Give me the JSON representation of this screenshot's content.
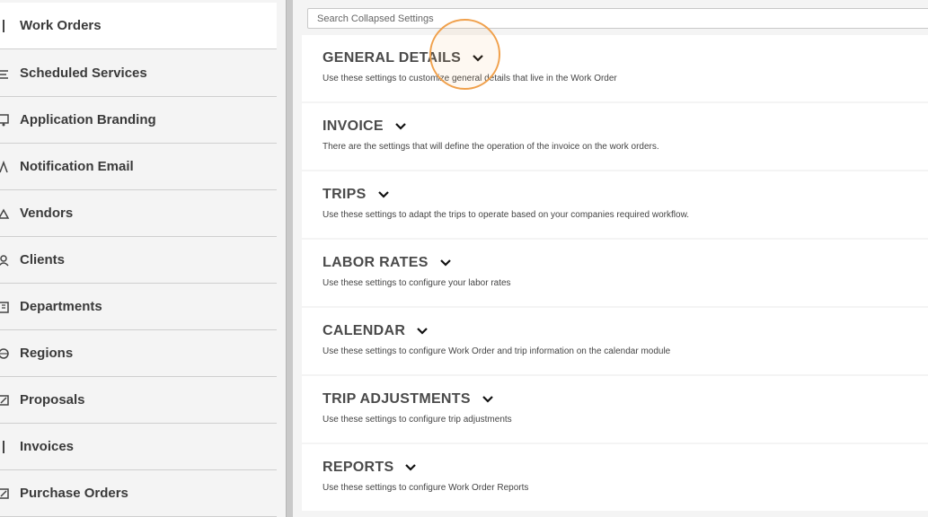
{
  "sidebar": {
    "items": [
      {
        "label": "Work Orders",
        "icon": "document-icon",
        "active": true
      },
      {
        "label": "Scheduled Services",
        "icon": "calendar-icon",
        "active": false
      },
      {
        "label": "Application Branding",
        "icon": "branding-icon",
        "active": false
      },
      {
        "label": "Notification Email",
        "icon": "email-icon",
        "active": false
      },
      {
        "label": "Vendors",
        "icon": "vendor-icon",
        "active": false
      },
      {
        "label": "Clients",
        "icon": "client-icon",
        "active": false
      },
      {
        "label": "Departments",
        "icon": "building-icon",
        "active": false
      },
      {
        "label": "Regions",
        "icon": "globe-icon",
        "active": false
      },
      {
        "label": "Proposals",
        "icon": "proposal-icon",
        "active": false
      },
      {
        "label": "Invoices",
        "icon": "invoice-icon",
        "active": false
      },
      {
        "label": "Purchase Orders",
        "icon": "purchase-order-icon",
        "active": false
      }
    ]
  },
  "search": {
    "placeholder": "Search Collapsed Settings"
  },
  "sections": [
    {
      "title": "GENERAL DETAILS",
      "description": "Use these settings to customize general details that live in the Work Order"
    },
    {
      "title": "INVOICE",
      "description": "There are the settings that will define the operation of the invoice on the work orders."
    },
    {
      "title": "TRIPS",
      "description": "Use these settings to adapt the trips to operate based on your companies required workflow."
    },
    {
      "title": "LABOR RATES",
      "description": "Use these settings to configure your labor rates"
    },
    {
      "title": "CALENDAR",
      "description": "Use these settings to configure Work Order and trip information on the calendar module"
    },
    {
      "title": "TRIP ADJUSTMENTS",
      "description": "Use these settings to configure trip adjustments"
    },
    {
      "title": "REPORTS",
      "description": "Use these settings to configure Work Order Reports"
    }
  ],
  "colors": {
    "focus_ring": "#f0a04b",
    "background": "#f4f4f4",
    "card": "#ffffff"
  }
}
